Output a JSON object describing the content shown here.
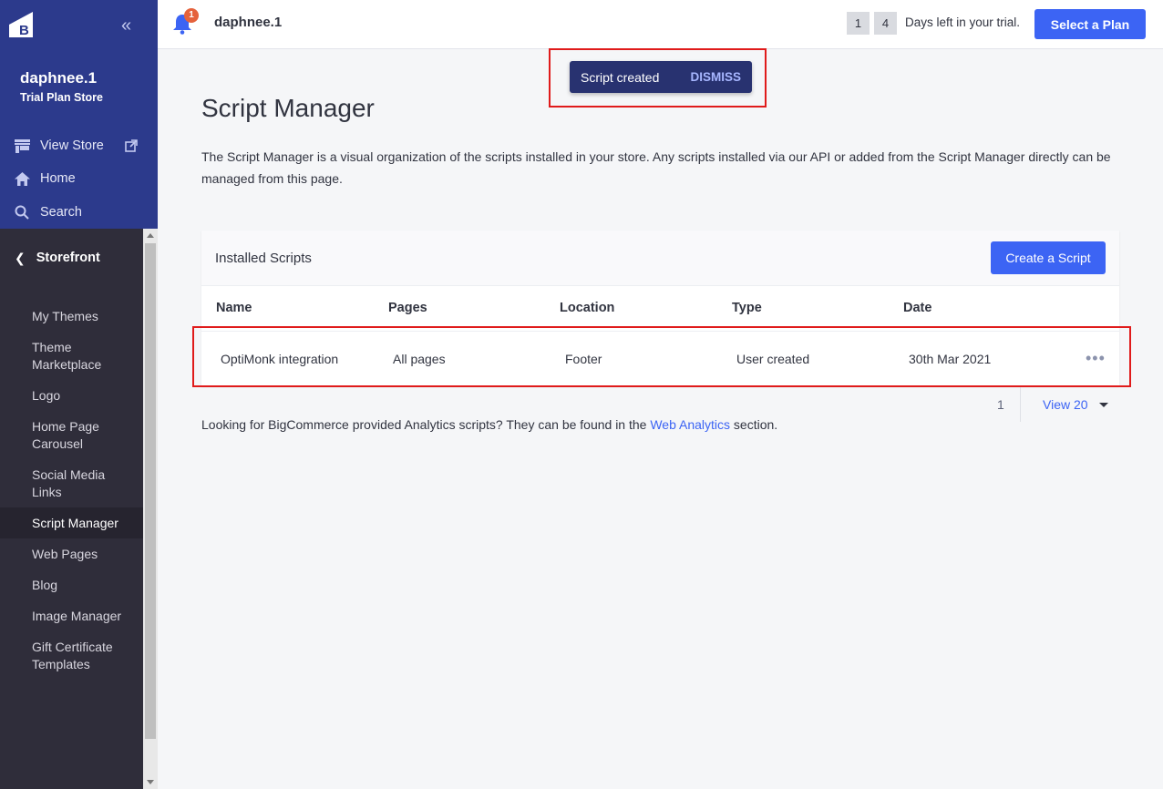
{
  "sidebar": {
    "store_name": "daphnee.1",
    "store_plan": "Trial Plan Store",
    "collapse_icon": "double-chevron-left-icon",
    "top_nav": [
      {
        "label": "View Store",
        "icon": "storefront-icon"
      },
      {
        "label": "Home",
        "icon": "home-icon"
      },
      {
        "label": "Search",
        "icon": "search-icon"
      }
    ],
    "section": "Storefront",
    "items": [
      {
        "label": "My Themes"
      },
      {
        "label": "Theme Marketplace"
      },
      {
        "label": "Logo"
      },
      {
        "label": "Home Page Carousel"
      },
      {
        "label": "Social Media Links"
      },
      {
        "label": "Script Manager",
        "active": true
      },
      {
        "label": "Web Pages"
      },
      {
        "label": "Blog"
      },
      {
        "label": "Image Manager"
      },
      {
        "label": "Gift Certificate Templates"
      }
    ]
  },
  "topbar": {
    "notification_count": "1",
    "store_name": "daphnee.1",
    "trial_digits": [
      "1",
      "4"
    ],
    "trial_text": "Days left in your trial.",
    "select_plan_label": "Select a Plan"
  },
  "toast": {
    "message": "Script created",
    "dismiss_label": "DISMISS"
  },
  "main": {
    "title": "Script Manager",
    "description": "The Script Manager is a visual organization of the scripts installed in your store. Any scripts installed via our API or added from the Script Manager directly can be managed from this page.",
    "card_title": "Installed Scripts",
    "create_label": "Create a Script",
    "columns": [
      "Name",
      "Pages",
      "Location",
      "Type",
      "Date"
    ],
    "rows": [
      {
        "name": "OptiMonk integration",
        "pages": "All pages",
        "location": "Footer",
        "type": "User created",
        "date": "30th Mar 2021"
      }
    ],
    "pager": {
      "page": "1",
      "view_label": "View 20"
    },
    "footnote_prefix": "Looking for BigCommerce provided Analytics scripts? They can be found in the ",
    "footnote_link": "Web Analytics",
    "footnote_suffix": " section."
  },
  "colors": {
    "sidebar_blue": "#2c3a8c",
    "sidebar_dark": "#34313f",
    "accent": "#3c64f4",
    "toast_bg": "#283270",
    "highlight_red": "#e01b1b",
    "badge": "#e5623c"
  }
}
